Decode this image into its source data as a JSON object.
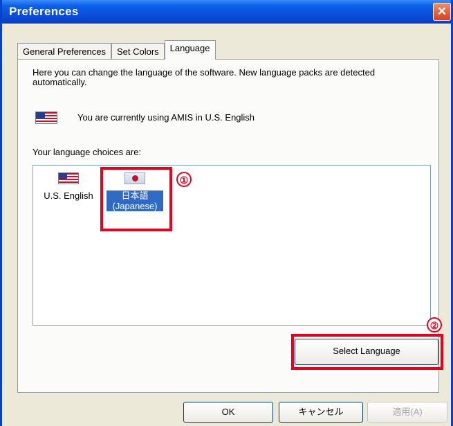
{
  "window": {
    "title": "Preferences",
    "close_glyph": "✕"
  },
  "tabs": [
    {
      "label": "General Preferences",
      "active": false
    },
    {
      "label": "Set Colors",
      "active": false
    },
    {
      "label": "Language",
      "active": true
    }
  ],
  "language_tab": {
    "intro": "Here you can change the language of the software. New language packs are detected automatically.",
    "current_text": "You are currently using AMIS in U.S. English",
    "choices_label": "Your language choices are:",
    "languages": [
      {
        "label": "U.S. English",
        "icon": "us-flag-icon",
        "selected": false
      },
      {
        "label": "日本語 (Japanese)",
        "icon": "japan-flag-icon",
        "selected": true
      }
    ],
    "select_button": "Select Language"
  },
  "annotations": {
    "marker1": "①",
    "marker2": "②",
    "color": "#E8001C"
  },
  "footer": {
    "ok": "OK",
    "cancel": "キャンセル",
    "apply": "適用(A)"
  },
  "colors": {
    "titlebar": "#0A4BD8",
    "selection": "#316AC5",
    "dialog_bg": "#ECE9D8"
  }
}
